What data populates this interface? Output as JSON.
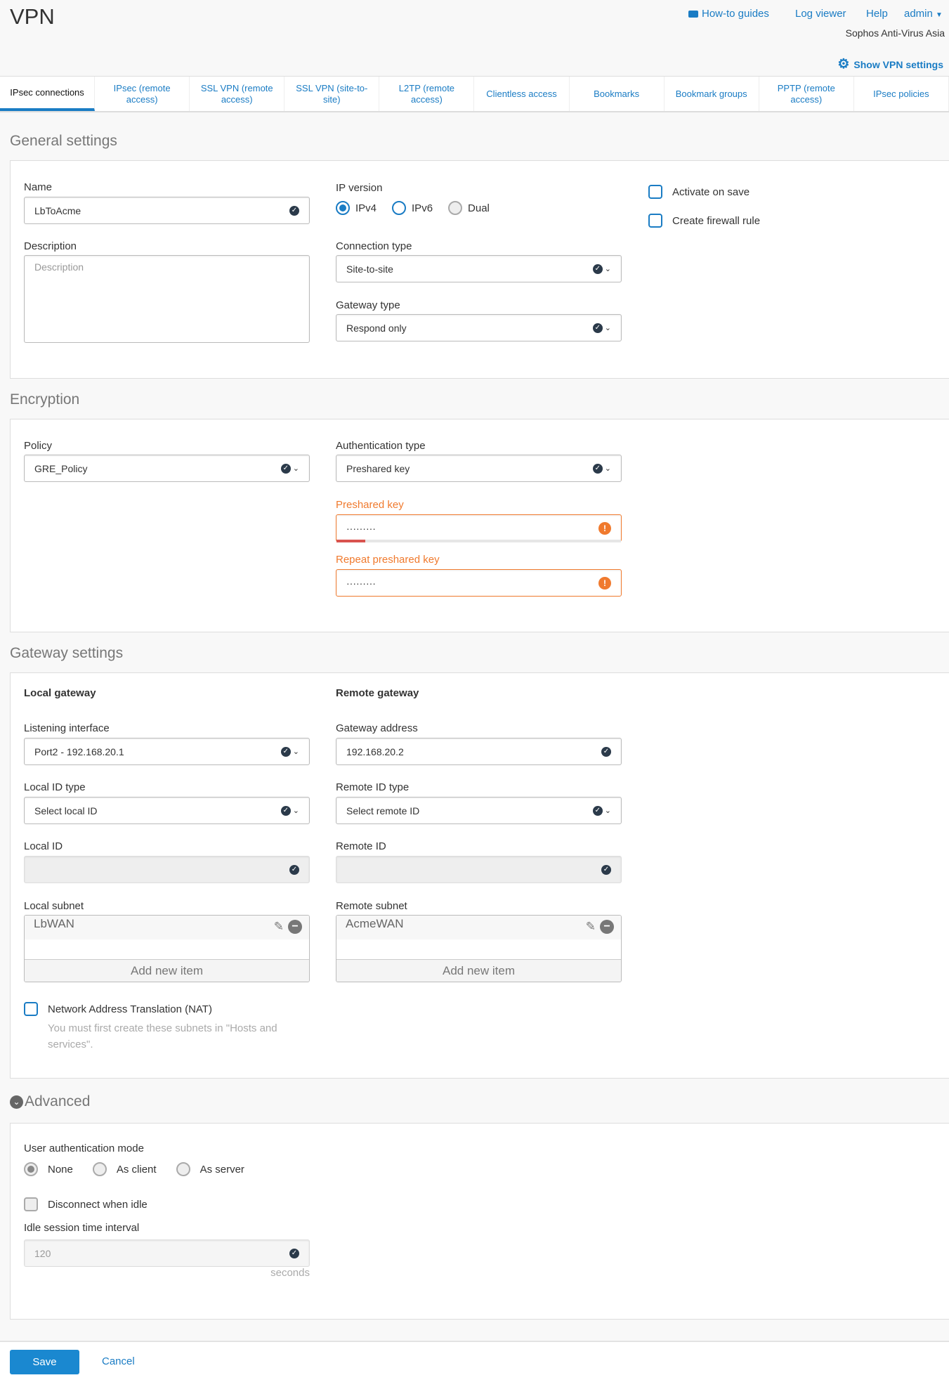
{
  "header": {
    "title": "VPN",
    "links": [
      "How-to guides",
      "Log viewer",
      "Help",
      "admin"
    ],
    "company": "Sophos Anti-Virus Asia",
    "show_settings": "Show VPN settings"
  },
  "tabs": [
    "IPsec connections",
    "IPsec (remote access)",
    "SSL VPN (remote access)",
    "SSL VPN (site-to-site)",
    "L2TP (remote access)",
    "Clientless access",
    "Bookmarks",
    "Bookmark groups",
    "PPTP (remote access)",
    "IPsec policies"
  ],
  "general": {
    "heading": "General settings",
    "name_label": "Name",
    "name_value": "LbToAcme",
    "desc_label": "Description",
    "desc_placeholder": "Description",
    "ipver_label": "IP version",
    "ipver_options": [
      "IPv4",
      "IPv6",
      "Dual"
    ],
    "conn_label": "Connection type",
    "conn_value": "Site-to-site",
    "gw_label": "Gateway type",
    "gw_value": "Respond only",
    "activate": "Activate on save",
    "firewall": "Create firewall rule"
  },
  "encryption": {
    "heading": "Encryption",
    "policy_label": "Policy",
    "policy_value": "GRE_Policy",
    "auth_label": "Authentication type",
    "auth_value": "Preshared key",
    "psk_label": "Preshared key",
    "psk_value": "·········",
    "repeat_label": "Repeat preshared key",
    "repeat_value": "·········",
    "psk_strength": 0.1
  },
  "gateway": {
    "heading": "Gateway settings",
    "local_title": "Local gateway",
    "remote_title": "Remote gateway",
    "listen_label": "Listening interface",
    "listen_value": "Port2 - 192.168.20.1",
    "gwaddr_label": "Gateway address",
    "gwaddr_value": "192.168.20.2",
    "localid_type_label": "Local ID type",
    "localid_type_value": "Select local ID",
    "remoteid_type_label": "Remote ID type",
    "remoteid_type_value": "Select remote ID",
    "localid_label": "Local ID",
    "remoteid_label": "Remote ID",
    "local_subnet_label": "Local subnet",
    "local_subnet_item": "LbWAN",
    "remote_subnet_label": "Remote subnet",
    "remote_subnet_item": "AcmeWAN",
    "add_item": "Add new item",
    "nat_label": "Network Address Translation (NAT)",
    "nat_help": "You must first create these subnets in \"Hosts and services\"."
  },
  "advanced": {
    "heading": "Advanced",
    "uam_label": "User authentication mode",
    "uam_options": [
      "None",
      "As client",
      "As server"
    ],
    "disconnect": "Disconnect when idle",
    "idle_label": "Idle session time interval",
    "idle_value": "120",
    "idle_unit": "seconds"
  },
  "footer": {
    "save": "Save",
    "cancel": "Cancel"
  },
  "colors": {
    "accent": "#1a88d0",
    "warning": "#f07a2e"
  }
}
